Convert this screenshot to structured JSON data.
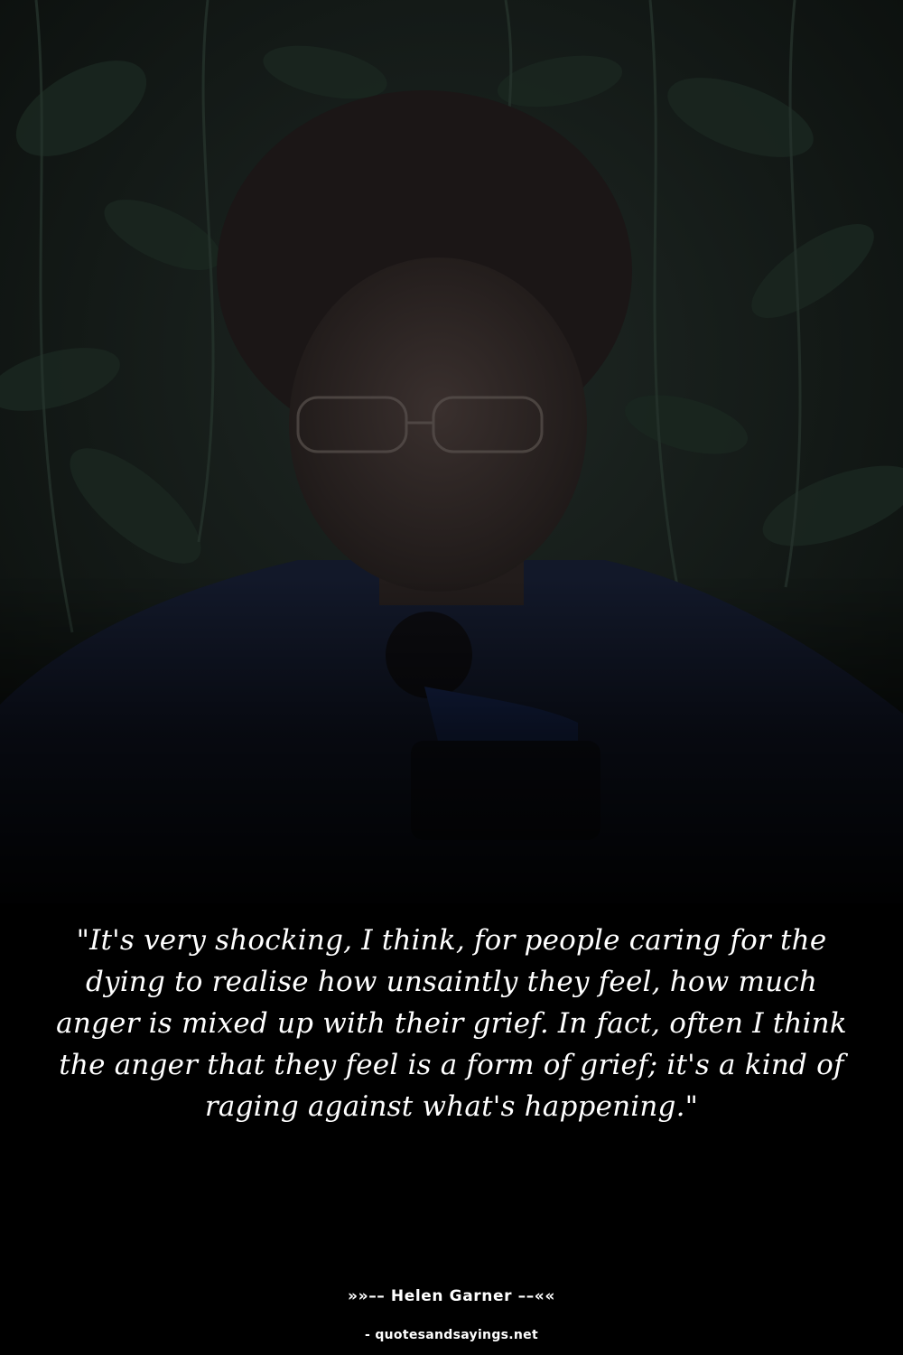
{
  "quote": {
    "text": "\"It's very shocking, I think, for people caring for the dying to realise how unsaintly they feel, how much anger is mixed up with their grief. In fact, often I think the anger that they feel is a form of grief; it's a kind of raging against what's happening.\""
  },
  "author": {
    "label": "»»–– Helen Garner ––««"
  },
  "source": {
    "label": "- quotesandsayings.net"
  },
  "colors": {
    "background": "#000000",
    "text": "#ffffff",
    "foliage": "#1d2a24",
    "jacket": "#141a2e"
  }
}
